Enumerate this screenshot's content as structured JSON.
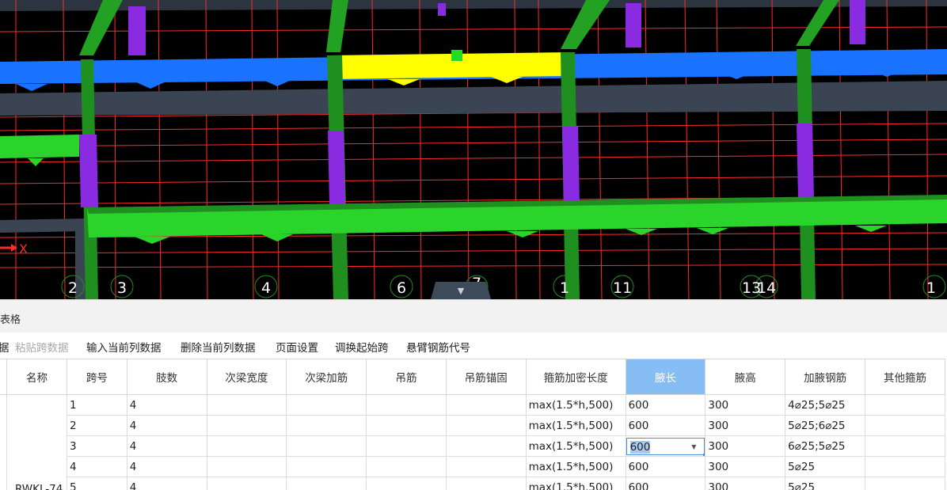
{
  "viewport": {
    "axis_labels": [
      "2",
      "3",
      "4",
      "6",
      "7",
      "1",
      "11",
      "13",
      "14",
      "1"
    ],
    "x_axis_marker": "X",
    "collapse_icon": "chevron-down-icon",
    "colors": {
      "background": "#000000",
      "grid": "#ff2a2a",
      "beam_blue": "#1a73ff",
      "beam_green": "#2ad42a",
      "beam_yellow": "#ffff00",
      "column": "#8a2be2",
      "wall": "#3a4452"
    }
  },
  "panel": {
    "title": "表格"
  },
  "toolbar": {
    "items": [
      {
        "label": "据",
        "enabled": true
      },
      {
        "label": "粘贴跨数据",
        "enabled": false
      },
      {
        "label": "输入当前列数据",
        "enabled": true
      },
      {
        "label": "删除当前列数据",
        "enabled": true
      },
      {
        "label": "页面设置",
        "enabled": true
      },
      {
        "label": "调换起始跨",
        "enabled": true
      },
      {
        "label": "悬臂钢筋代号",
        "enabled": true
      }
    ]
  },
  "table": {
    "columns": [
      "名称",
      "跨号",
      "肢数",
      "次梁宽度",
      "次梁加筋",
      "吊筋",
      "吊筋锚固",
      "箍筋加密长度",
      "腋长",
      "腋高",
      "加腋钢筋",
      "其他箍筋"
    ],
    "selected_column": "腋长",
    "group_name": "RWKL-74",
    "rows": [
      [
        "1",
        "4",
        "",
        "",
        "",
        "",
        "max(1.5*h,500)",
        "600",
        "300",
        "4⌀25;5⌀25",
        ""
      ],
      [
        "2",
        "4",
        "",
        "",
        "",
        "",
        "max(1.5*h,500)",
        "600",
        "300",
        "5⌀25;6⌀25",
        ""
      ],
      [
        "3",
        "4",
        "",
        "",
        "",
        "",
        "max(1.5*h,500)",
        "600",
        "300",
        "6⌀25;5⌀25",
        ""
      ],
      [
        "4",
        "4",
        "",
        "",
        "",
        "",
        "max(1.5*h,500)",
        "600",
        "300",
        "5⌀25",
        ""
      ],
      [
        "5",
        "4",
        "",
        "",
        "",
        "",
        "max(1.5*h,500)",
        "600",
        "300",
        "5⌀25",
        ""
      ]
    ],
    "editing": {
      "row": 2,
      "column": "腋长",
      "value": "600"
    }
  }
}
